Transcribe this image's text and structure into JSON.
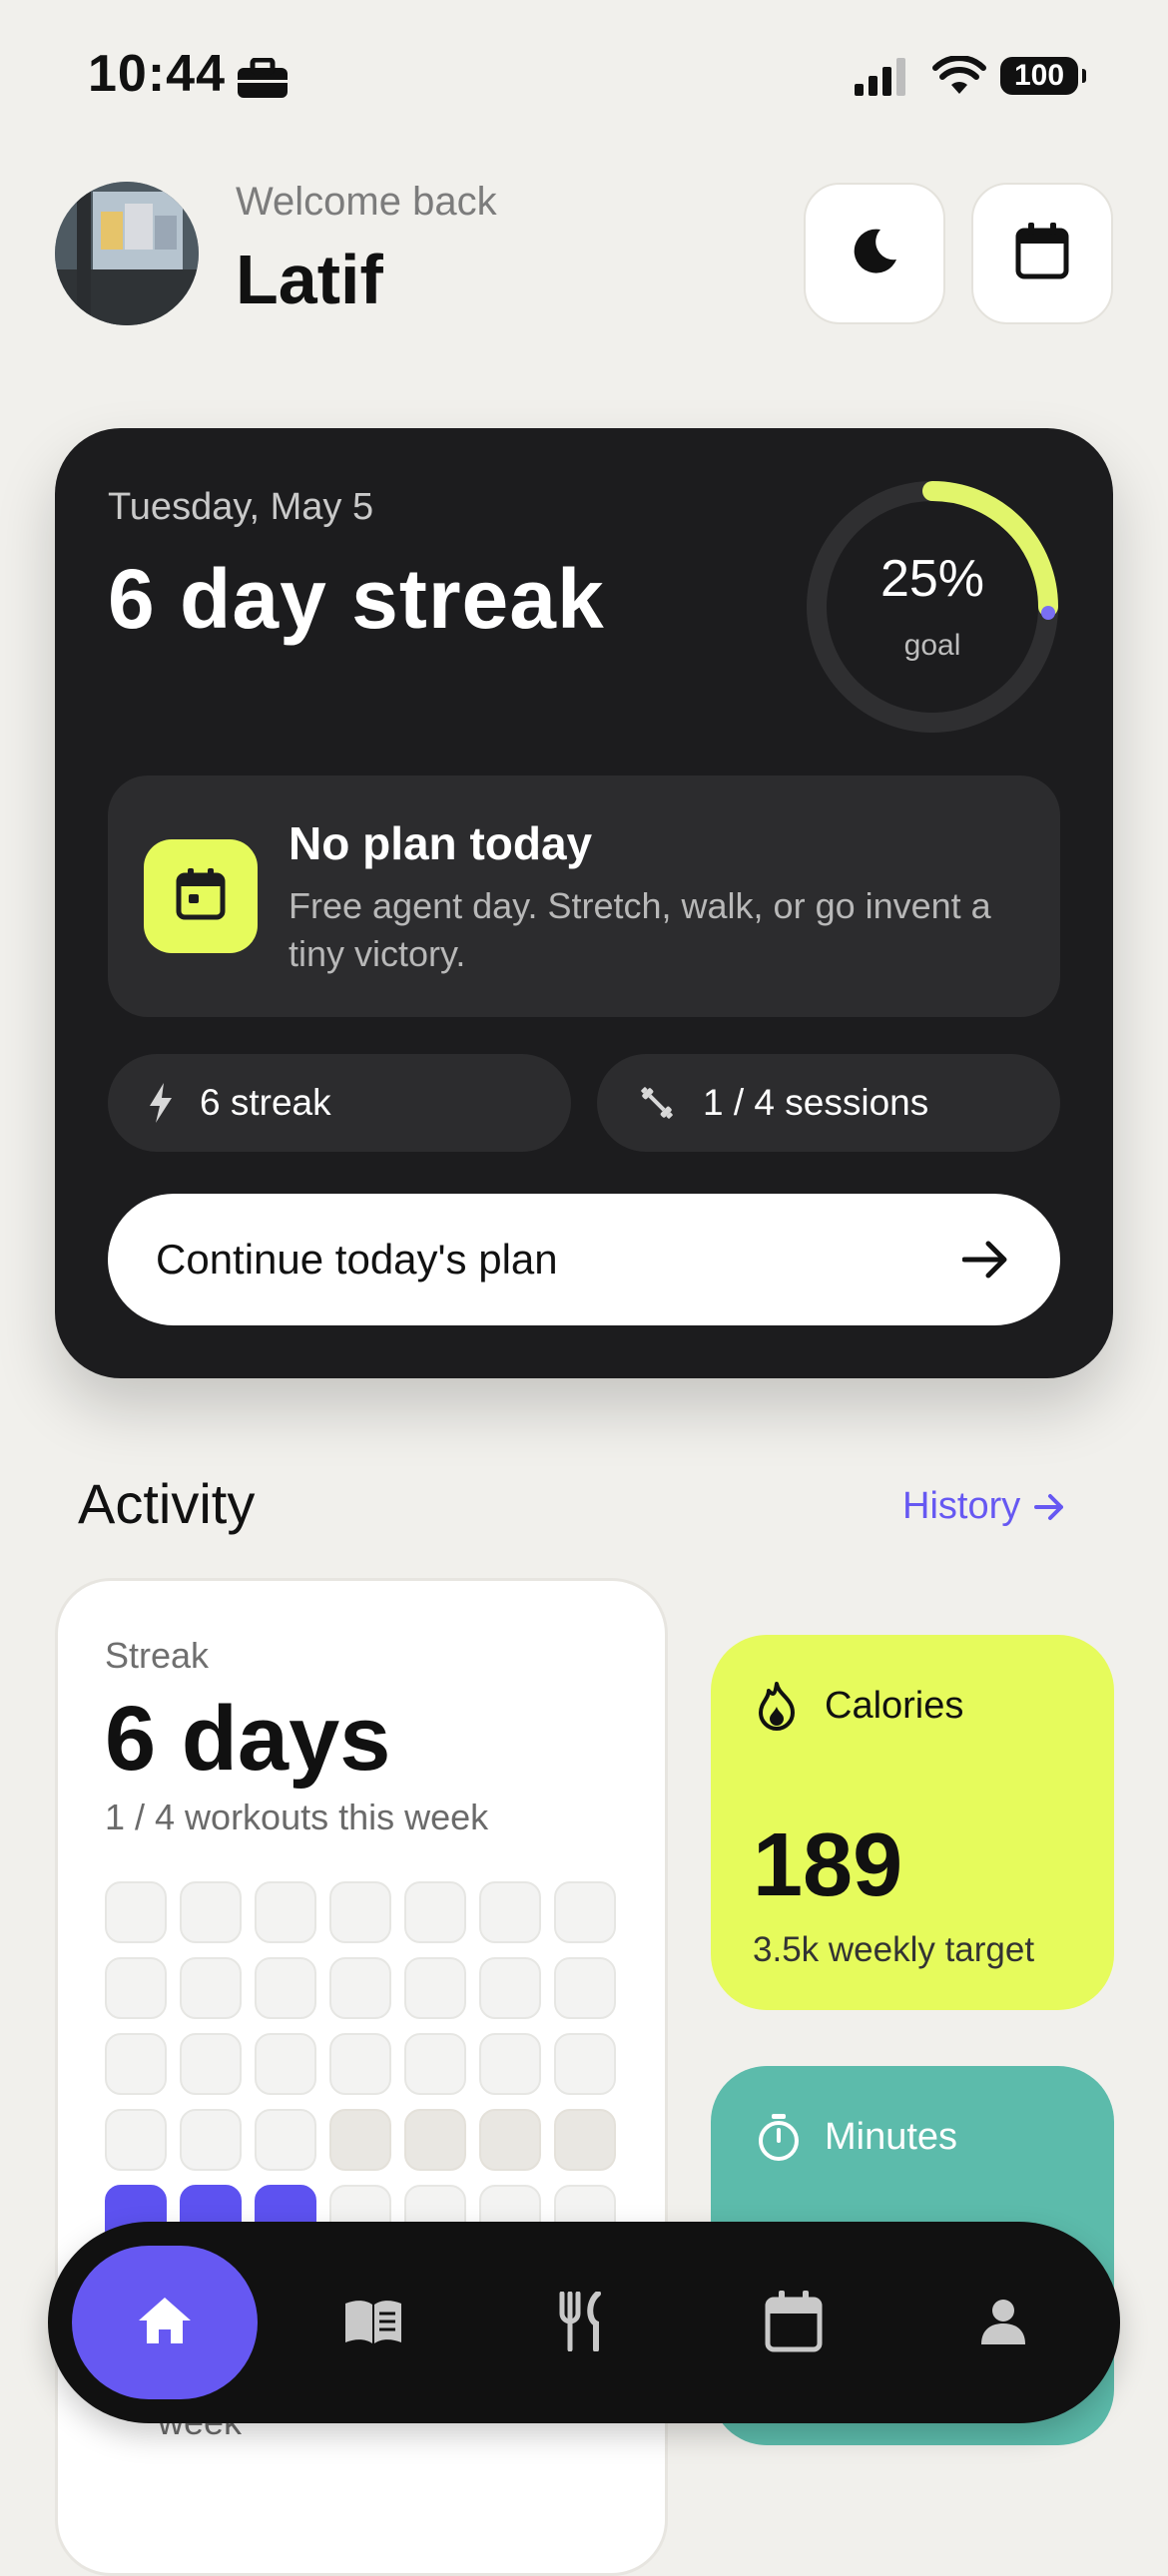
{
  "status_bar": {
    "time": "10:44",
    "battery": "100"
  },
  "header": {
    "welcome": "Welcome back",
    "username": "Latif"
  },
  "hero": {
    "date": "Tuesday, May 5",
    "title": "6 day streak",
    "goal_value": "25%",
    "goal_label": "goal",
    "goal_progress": 0.25,
    "plan_title": "No plan today",
    "plan_desc": "Free agent day. Stretch, walk, or go invent a tiny victory.",
    "streak_pill": "6 streak",
    "sessions_pill": "1 / 4 sessions",
    "cta_label": "Continue today's plan"
  },
  "activity": {
    "title": "Activity",
    "history_link": "History",
    "streak_card": {
      "label": "Streak",
      "value": "6 days",
      "subtitle": "1 / 4 workouts this week",
      "footer": "week"
    },
    "calories_card": {
      "label": "Calories",
      "value": "189",
      "subtitle": "3.5k weekly target"
    },
    "minutes_card": {
      "label": "Minutes"
    }
  },
  "colors": {
    "accent": "#6658f2",
    "lime": "#e6fb5c",
    "teal": "#5cbbab",
    "dark": "#1c1c1e"
  }
}
